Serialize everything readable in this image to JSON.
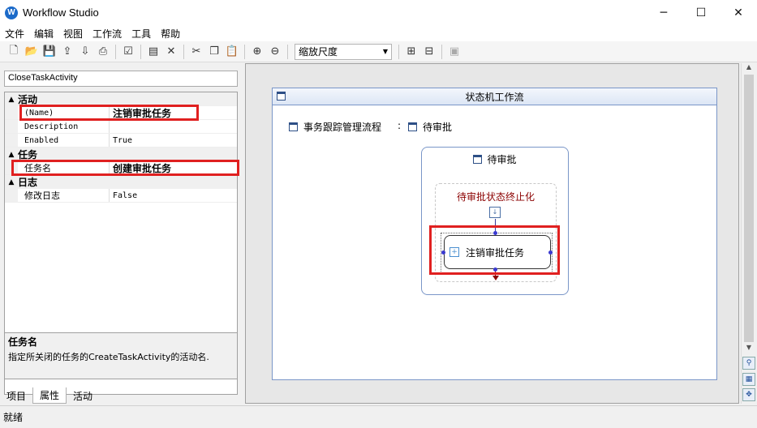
{
  "window": {
    "title": "Workflow Studio",
    "minimize": "─",
    "maximize": "☐",
    "close": "✕"
  },
  "menu": [
    "文件",
    "编辑",
    "视图",
    "工作流",
    "工具",
    "帮助"
  ],
  "toolbar": {
    "zoom_label": "缩放尺度"
  },
  "left_panel": {
    "object_selector": "CloseTaskActivity",
    "categories": [
      {
        "name": "活动",
        "toggle": "▲"
      },
      {
        "name": "任务",
        "toggle": "▲"
      },
      {
        "name": "日志",
        "toggle": "▲"
      }
    ],
    "props": {
      "name_key": "(Name)",
      "name_val": "注销审批任务",
      "desc_key": "Description",
      "desc_val": "",
      "enabled_key": "Enabled",
      "enabled_val": "True",
      "task_key": "任务名",
      "task_val": "创建审批任务",
      "log_key": "修改日志",
      "log_val": "False"
    },
    "description": {
      "title": "任务名",
      "text": "指定所关闭的任务的CreateTaskActivity的活动名."
    },
    "tabs": [
      "项目",
      "属性",
      "活动"
    ]
  },
  "designer": {
    "canvas_title": "状态机工作流",
    "flow_label": "事务跟踪管理流程",
    "separator": ":",
    "current_state": "待审批",
    "state_box_title": "待审批",
    "finalize_label": "待审批状态终止化",
    "activity_label": "注销审批任务"
  },
  "status": {
    "text": "就绪"
  },
  "colors": {
    "highlight_red": "#e02020",
    "finalize_text": "#8b0000",
    "state_border": "#7a96c8"
  }
}
